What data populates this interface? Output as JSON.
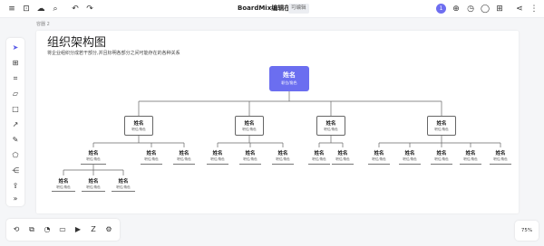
{
  "topbar": {
    "title": "BoardMix编辑在...",
    "mode": "可编辑",
    "avatar": "1"
  },
  "breadcrumb": "容器 2",
  "page": {
    "heading": "组织架构图",
    "description": "将企业组织分成若干部分,并且标明各部分之间可能存在的各种关系"
  },
  "org": {
    "root": {
      "name": "姓名",
      "role": "职位/角色"
    },
    "level2": [
      {
        "name": "姓名",
        "role": "职位/角色"
      },
      {
        "name": "姓名",
        "role": "职位/角色"
      },
      {
        "name": "姓名",
        "role": "职位/角色"
      },
      {
        "name": "姓名",
        "role": "职位/角色"
      }
    ],
    "level3": [
      {
        "name": "姓名",
        "role": "职位/角色"
      },
      {
        "name": "姓名",
        "role": "职位/角色"
      },
      {
        "name": "姓名",
        "role": "职位/角色"
      },
      {
        "name": "姓名",
        "role": "职位/角色"
      },
      {
        "name": "姓名",
        "role": "职位/角色"
      },
      {
        "name": "姓名",
        "role": "职位/角色"
      },
      {
        "name": "姓名",
        "role": "职位/角色"
      },
      {
        "name": "姓名",
        "role": "职位/角色"
      },
      {
        "name": "姓名",
        "role": "职位/角色"
      },
      {
        "name": "姓名",
        "role": "职位/角色"
      },
      {
        "name": "姓名",
        "role": "职位/角色"
      },
      {
        "name": "姓名",
        "role": "职位/角色"
      },
      {
        "name": "姓名",
        "role": "职位/角色"
      },
      {
        "name": "姓名",
        "role": "职位/角色"
      },
      {
        "name": "姓名",
        "role": "职位/角色"
      }
    ],
    "level4": [
      {
        "name": "姓名",
        "role": "职位/角色"
      },
      {
        "name": "姓名",
        "role": "职位/角色"
      },
      {
        "name": "姓名",
        "role": "职位/角色"
      }
    ]
  },
  "zoom": "75%",
  "colors": {
    "accent": "#6b6ef0",
    "canvas": "#ffffff",
    "background": "#f5f6f8"
  },
  "icons": {
    "topbar": [
      "menu-icon",
      "save-icon",
      "cloud-icon",
      "search-icon",
      "undo-icon",
      "redo-icon",
      "add-icon",
      "timer-icon",
      "comment-icon",
      "grid-icon",
      "share-icon",
      "more-icon"
    ],
    "toolbar": [
      "select-icon",
      "frame-icon",
      "crop-icon",
      "sticky-note-icon",
      "shape-icon",
      "connector-icon",
      "pen-icon",
      "polygon-icon",
      "mindmap-icon",
      "upload-icon",
      "expand-icon"
    ],
    "bottombar": [
      "layers-icon",
      "copy-icon",
      "timer-icon",
      "chat-icon",
      "video-icon",
      "sleep-icon",
      "settings-icon"
    ]
  }
}
